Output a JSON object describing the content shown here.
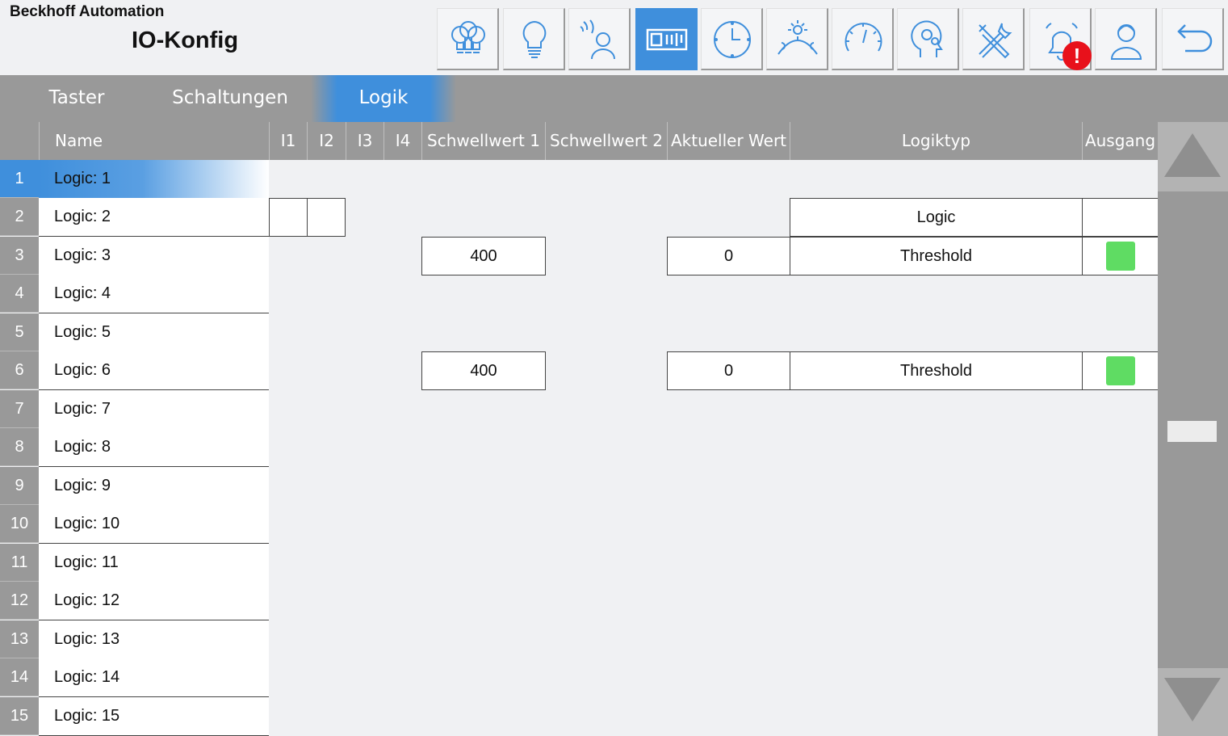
{
  "header": {
    "brand": "Beckhoff Automation",
    "title": "IO-Konfig",
    "nav_buttons": [
      {
        "icon": "bulbs-group-icon",
        "active": false
      },
      {
        "icon": "bulb-icon",
        "active": false
      },
      {
        "icon": "presence-sensor-icon",
        "active": false
      },
      {
        "icon": "io-config-icon",
        "active": true
      },
      {
        "icon": "clock-icon",
        "active": false
      },
      {
        "icon": "daylight-icon",
        "active": false
      },
      {
        "icon": "gauge-icon",
        "active": false
      },
      {
        "icon": "head-gears-icon",
        "active": false
      },
      {
        "icon": "tools-icon",
        "active": false
      },
      {
        "icon": "alarm-bell-icon",
        "active": false,
        "badge": "!"
      },
      {
        "icon": "user-icon",
        "active": false
      },
      {
        "icon": "back-arrow-icon",
        "active": false
      }
    ]
  },
  "tabs": [
    {
      "label": "Taster",
      "active": false
    },
    {
      "label": "Schaltungen",
      "active": false
    },
    {
      "label": "Logik",
      "active": true
    }
  ],
  "table": {
    "columns": [
      "Name",
      "I1",
      "I2",
      "I3",
      "I4",
      "Schwellwert 1",
      "Schwellwert 2",
      "Aktueller Wert",
      "Logiktyp",
      "Ausgang"
    ],
    "rows": [
      {
        "num": "1",
        "name": "Logic: 1",
        "active": true
      },
      {
        "num": "2",
        "name": "Logic: 2",
        "logic_type": "Logic",
        "inputs": true
      },
      {
        "num": "3",
        "name": "Logic: 3",
        "threshold1": "400",
        "current": "0",
        "logic_type": "Threshold",
        "output": "on"
      },
      {
        "num": "4",
        "name": "Logic: 4"
      },
      {
        "num": "5",
        "name": "Logic: 5"
      },
      {
        "num": "6",
        "name": "Logic: 6",
        "threshold1": "400",
        "current": "0",
        "logic_type": "Threshold",
        "output": "on"
      },
      {
        "num": "7",
        "name": "Logic: 7"
      },
      {
        "num": "8",
        "name": "Logic: 8"
      },
      {
        "num": "9",
        "name": "Logic: 9"
      },
      {
        "num": "10",
        "name": "Logic: 10"
      },
      {
        "num": "11",
        "name": "Logic: 11"
      },
      {
        "num": "12",
        "name": "Logic: 12"
      },
      {
        "num": "13",
        "name": "Logic: 13"
      },
      {
        "num": "14",
        "name": "Logic: 14"
      },
      {
        "num": "15",
        "name": "Logic: 15"
      }
    ]
  },
  "colors": {
    "accent": "#3f8fdc",
    "output_on": "#5fdc63",
    "alarm": "#e8111b",
    "header_gray": "#999999"
  }
}
